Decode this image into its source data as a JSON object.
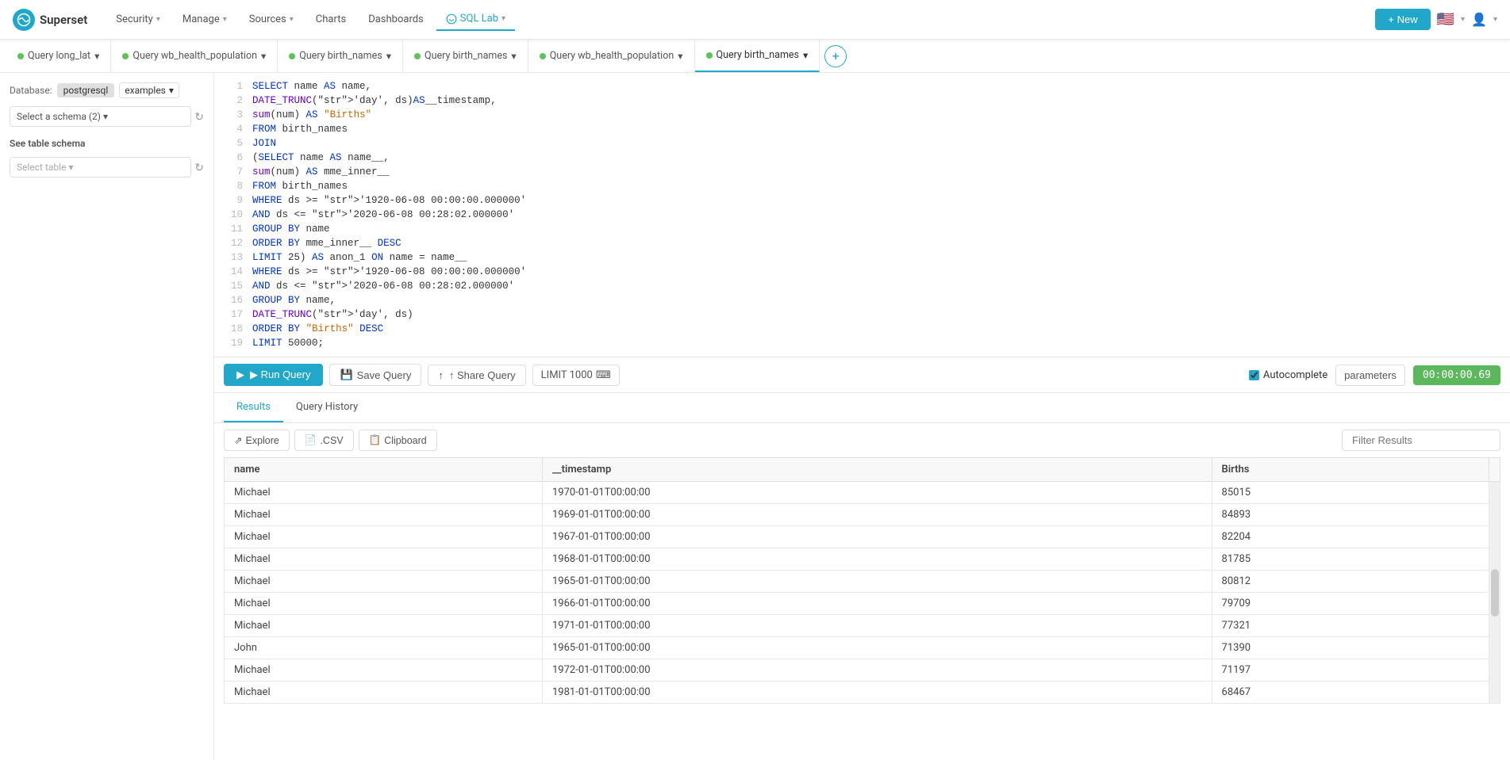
{
  "navbar": {
    "brand": "Superset",
    "logo_symbol": "∞",
    "nav_items": [
      {
        "label": "Security",
        "has_dropdown": true,
        "active": false
      },
      {
        "label": "Manage",
        "has_dropdown": true,
        "active": false
      },
      {
        "label": "Sources",
        "has_dropdown": true,
        "active": false
      },
      {
        "label": "Charts",
        "has_dropdown": false,
        "active": false
      },
      {
        "label": "Dashboards",
        "has_dropdown": false,
        "active": false
      },
      {
        "label": "SQL Lab",
        "has_dropdown": true,
        "active": true
      }
    ],
    "new_button": "+ New",
    "flag": "🇺🇸"
  },
  "query_tabs": [
    {
      "label": "Query long_lat",
      "active": false
    },
    {
      "label": "Query wb_health_population",
      "active": false
    },
    {
      "label": "Query birth_names",
      "active": false
    },
    {
      "label": "Query birth_names",
      "active": false
    },
    {
      "label": "Query wb_health_population",
      "active": false
    },
    {
      "label": "Query birth_names",
      "active": true
    }
  ],
  "sidebar": {
    "db_label": "Database:",
    "db_badge": "postgresql",
    "db_select": "examples",
    "schema_placeholder": "Select a schema (2)",
    "section_title": "See table schema",
    "table_placeholder": "Select table"
  },
  "editor": {
    "lines": [
      {
        "num": 1,
        "code": "SELECT name AS name,"
      },
      {
        "num": 2,
        "code": "       DATE_TRUNC('day', ds) AS __timestamp,"
      },
      {
        "num": 3,
        "code": "       sum(num) AS \"Births\""
      },
      {
        "num": 4,
        "code": "FROM birth_names"
      },
      {
        "num": 5,
        "code": "JOIN"
      },
      {
        "num": 6,
        "code": "  (SELECT name AS name__,"
      },
      {
        "num": 7,
        "code": "          sum(num) AS mme_inner__"
      },
      {
        "num": 8,
        "code": "   FROM birth_names"
      },
      {
        "num": 9,
        "code": "   WHERE ds >= '1920-06-08 00:00:00.000000'"
      },
      {
        "num": 10,
        "code": "     AND ds <= '2020-06-08 00:28:02.000000'"
      },
      {
        "num": 11,
        "code": "   GROUP BY name"
      },
      {
        "num": 12,
        "code": "   ORDER BY mme_inner__ DESC"
      },
      {
        "num": 13,
        "code": "   LIMIT 25) AS anon_1 ON name = name__"
      },
      {
        "num": 14,
        "code": "WHERE ds >= '1920-06-08 00:00:00.000000'"
      },
      {
        "num": 15,
        "code": "  AND ds <= '2020-06-08 00:28:02.000000'"
      },
      {
        "num": 16,
        "code": "GROUP BY name,"
      },
      {
        "num": 17,
        "code": "         DATE_TRUNC('day', ds)"
      },
      {
        "num": 18,
        "code": "ORDER BY \"Births\" DESC"
      },
      {
        "num": 19,
        "code": "LIMIT 50000;"
      }
    ],
    "run_label": "▶ Run Query",
    "save_label": "💾 Save Query",
    "share_label": "↑ Share Query",
    "limit_label": "LIMIT 1000",
    "autocomplete_label": "Autocomplete",
    "autocomplete_checked": true,
    "params_label": "parameters",
    "timer": "00:00:00.69"
  },
  "results": {
    "tab_results": "Results",
    "tab_history": "Query History",
    "btn_explore": "⇗ Explore",
    "btn_csv": "📄 .CSV",
    "btn_clipboard": "📋 Clipboard",
    "filter_placeholder": "Filter Results",
    "columns": [
      "name",
      "__timestamp",
      "Births"
    ],
    "rows": [
      {
        "name": "Michael",
        "timestamp": "1970-01-01T00:00:00",
        "births": "85015"
      },
      {
        "name": "Michael",
        "timestamp": "1969-01-01T00:00:00",
        "births": "84893"
      },
      {
        "name": "Michael",
        "timestamp": "1967-01-01T00:00:00",
        "births": "82204"
      },
      {
        "name": "Michael",
        "timestamp": "1968-01-01T00:00:00",
        "births": "81785"
      },
      {
        "name": "Michael",
        "timestamp": "1965-01-01T00:00:00",
        "births": "80812"
      },
      {
        "name": "Michael",
        "timestamp": "1966-01-01T00:00:00",
        "births": "79709"
      },
      {
        "name": "Michael",
        "timestamp": "1971-01-01T00:00:00",
        "births": "77321"
      },
      {
        "name": "John",
        "timestamp": "1965-01-01T00:00:00",
        "births": "71390"
      },
      {
        "name": "Michael",
        "timestamp": "1972-01-01T00:00:00",
        "births": "71197"
      },
      {
        "name": "Michael",
        "timestamp": "1981-01-01T00:00:00",
        "births": "68467"
      }
    ]
  }
}
